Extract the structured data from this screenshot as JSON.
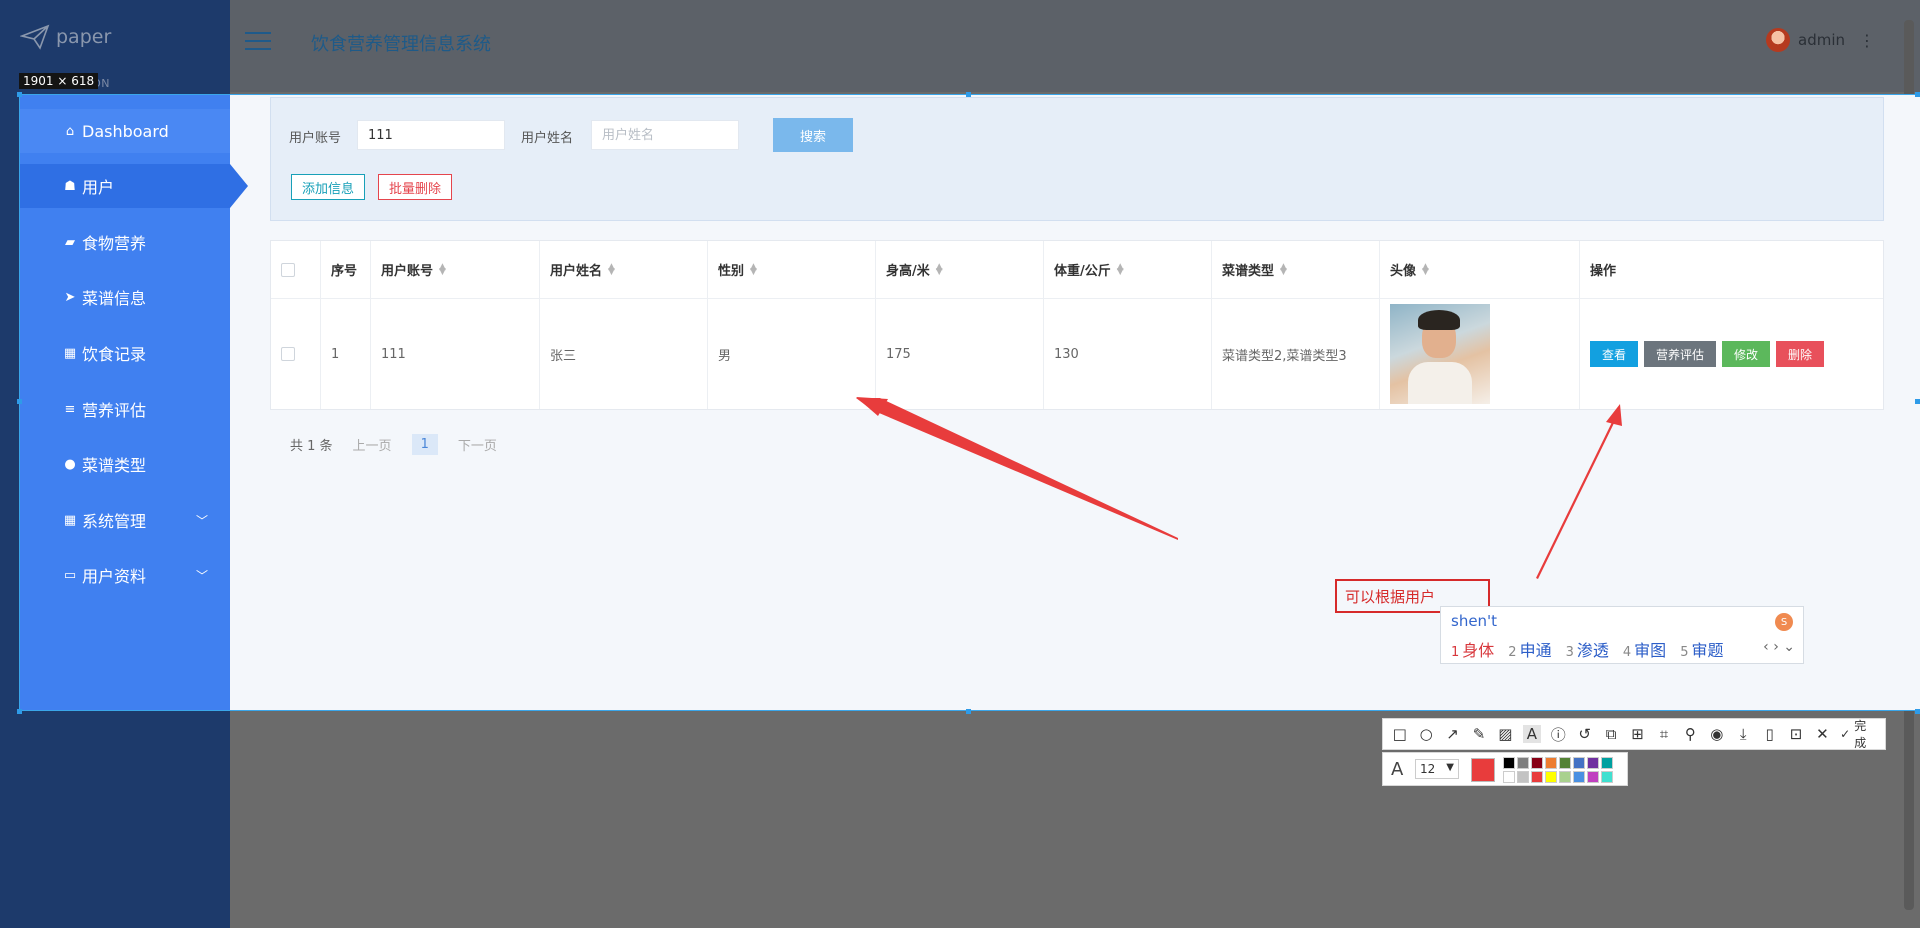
{
  "brand": {
    "name": "paper"
  },
  "nav_ghost_text": "ATION",
  "app_title": "饮食营养管理信息系统",
  "user": {
    "name": "admin"
  },
  "capture_size": "1901 × 618",
  "menu": [
    {
      "label": "Dashboard",
      "icon": "home-icon"
    },
    {
      "label": "用户",
      "icon": "user-group-icon"
    },
    {
      "label": "食物营养",
      "icon": "chat-icon"
    },
    {
      "label": "菜谱信息",
      "icon": "send-icon"
    },
    {
      "label": "饮食记录",
      "icon": "grid-icon"
    },
    {
      "label": "营养评估",
      "icon": "list-icon"
    },
    {
      "label": "菜谱类型",
      "icon": "person-icon"
    },
    {
      "label": "系统管理",
      "icon": "apps-icon"
    },
    {
      "label": "用户资料",
      "icon": "card-icon"
    }
  ],
  "search": {
    "account_label": "用户账号",
    "account_value": "111",
    "name_label": "用户姓名",
    "name_placeholder": "用户姓名",
    "search_button": "搜索",
    "add_button": "添加信息",
    "batch_delete_button": "批量删除"
  },
  "table": {
    "headers": [
      "序号",
      "用户账号",
      "用户姓名",
      "性别",
      "身高/米",
      "体重/公斤",
      "菜谱类型",
      "头像",
      "操作"
    ],
    "rows": [
      {
        "index": "1",
        "account": "111",
        "name": "张三",
        "gender": "男",
        "height": "175",
        "weight": "130",
        "recipe_type": "菜谱类型2,菜谱类型3"
      }
    ],
    "actions": {
      "view": "查看",
      "assess": "营养评估",
      "edit": "修改",
      "delete": "删除"
    }
  },
  "pagination": {
    "total": "共 1 条",
    "prev": "上一页",
    "page": "1",
    "next": "下一页"
  },
  "annotation": {
    "text": "可以根据用户"
  },
  "ime": {
    "composition": "shen't",
    "candidates": [
      {
        "n": "1",
        "text": "身体"
      },
      {
        "n": "2",
        "text": "申通"
      },
      {
        "n": "3",
        "text": "渗透"
      },
      {
        "n": "4",
        "text": "审图"
      },
      {
        "n": "5",
        "text": "审题"
      }
    ]
  },
  "toolbar": {
    "done_label": "完成",
    "font_size": "12"
  },
  "colors": {
    "sidebar": "#4080f0",
    "active": "#2f6fe4",
    "view_btn": "#12a0e0",
    "assess_btn": "#6c757d",
    "edit_btn": "#5cb85c",
    "delete_btn": "#e8505b",
    "annotation": "#e83c3c",
    "swatches": [
      "#000000",
      "#7f7f7f",
      "#880015",
      "#ed7d31",
      "#548235",
      "#4472c4",
      "#7030a0",
      "#00a0a0",
      "#ffffff",
      "#c3c3c3",
      "#e83c3c",
      "#ffff00",
      "#a9d18e",
      "#4a90e2",
      "#c040c0",
      "#40e0d0"
    ]
  }
}
